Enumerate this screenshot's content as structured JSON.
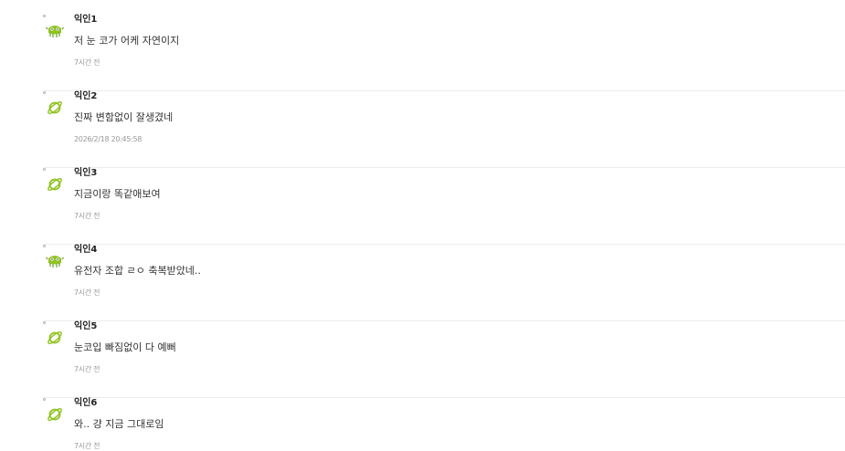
{
  "colors": {
    "icon_green": "#8fc31f",
    "icon_deep_green": "#6aa22b",
    "divider": "#ececec",
    "time_text": "#9a9a9a"
  },
  "comments": [
    {
      "nickname": "익인1",
      "text": "저 눈 코가 어케 자연이지",
      "time": "7시간 전",
      "icon": "monster-icon"
    },
    {
      "nickname": "익인2",
      "text": "진짜 변함없이 잘생겼네",
      "time": "2026/2/18 20:45:58",
      "icon": "planet-icon"
    },
    {
      "nickname": "익인3",
      "text": "지금이랑 똑같애보여",
      "time": "7시간 전",
      "icon": "planet-icon"
    },
    {
      "nickname": "익인4",
      "text": "유전자 조합 ㄹㅇ 축복받았네..",
      "time": "7시간 전",
      "icon": "monster-icon"
    },
    {
      "nickname": "익인5",
      "text": "눈코입 빠짐없이 다 예뻐",
      "time": "7시간 전",
      "icon": "planet-icon"
    },
    {
      "nickname": "익인6",
      "text": "와.. 걍 지금 그대로임",
      "time": "7시간 전",
      "icon": "planet-icon"
    }
  ]
}
